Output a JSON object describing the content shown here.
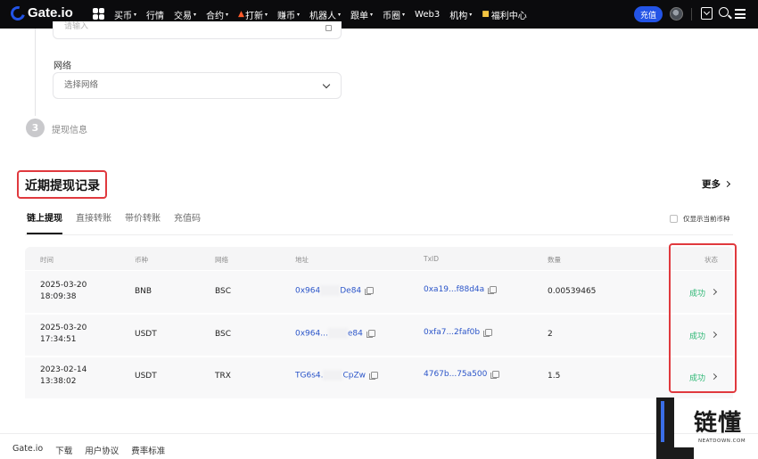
{
  "nav": {
    "logo": "Gate.io",
    "items": [
      {
        "label": "买币",
        "caret": "▾"
      },
      {
        "label": "行情",
        "caret": ""
      },
      {
        "label": "交易",
        "caret": "▾"
      },
      {
        "label": "合约",
        "caret": "▾"
      },
      {
        "label": "打新",
        "caret": "▾"
      },
      {
        "label": "赚币",
        "caret": "▾"
      },
      {
        "label": "机器人",
        "caret": "▾"
      },
      {
        "label": "跟单",
        "caret": "▾"
      },
      {
        "label": "币圈",
        "caret": "▾"
      },
      {
        "label": "Web3",
        "caret": ""
      },
      {
        "label": "机构",
        "caret": "▾"
      },
      {
        "label": "福利中心",
        "caret": ""
      }
    ],
    "deposit_label": "充值"
  },
  "form": {
    "address_placeholder": "请输入",
    "network_label": "网络",
    "network_placeholder": "选择网络",
    "step_number": "3",
    "step_label": "提现信息"
  },
  "history": {
    "title": "近期提现记录",
    "more_label": "更多",
    "tabs": [
      "链上提现",
      "直接转账",
      "带价转账",
      "充值码"
    ],
    "only_current_label": "仅显示当前币种",
    "columns": [
      "时间",
      "币种",
      "网络",
      "地址",
      "TxID",
      "数量",
      "状态"
    ],
    "rows": [
      {
        "date": "2025-03-20",
        "time": "18:09:38",
        "coin": "BNB",
        "network": "BSC",
        "addr_start": "0x964",
        "addr_end": "De84",
        "txid": "0xa19...f88d4a",
        "amount": "0.00539465",
        "status": "成功"
      },
      {
        "date": "2025-03-20",
        "time": "17:34:51",
        "coin": "USDT",
        "network": "BSC",
        "addr_start": "0x964...",
        "addr_end": "e84",
        "txid": "0xfa7...2faf0b",
        "amount": "2",
        "status": "成功"
      },
      {
        "date": "2023-02-14",
        "time": "13:38:02",
        "coin": "USDT",
        "network": "TRX",
        "addr_start": "TG6s4.",
        "addr_end": "CpZw",
        "txid": "4767b...75a500",
        "amount": "1.5",
        "status": "成功"
      }
    ]
  },
  "footer": {
    "links": [
      "Gate.io",
      "下载",
      "用户协议",
      "费率标准"
    ]
  },
  "watermark": {
    "text": "链懂",
    "sub": "NEATDOWN.COM"
  },
  "colors": {
    "brand_blue": "#2354e6",
    "success_green": "#2bb673",
    "highlight_red": "#e0393e",
    "link_blue": "#2b55c9"
  }
}
